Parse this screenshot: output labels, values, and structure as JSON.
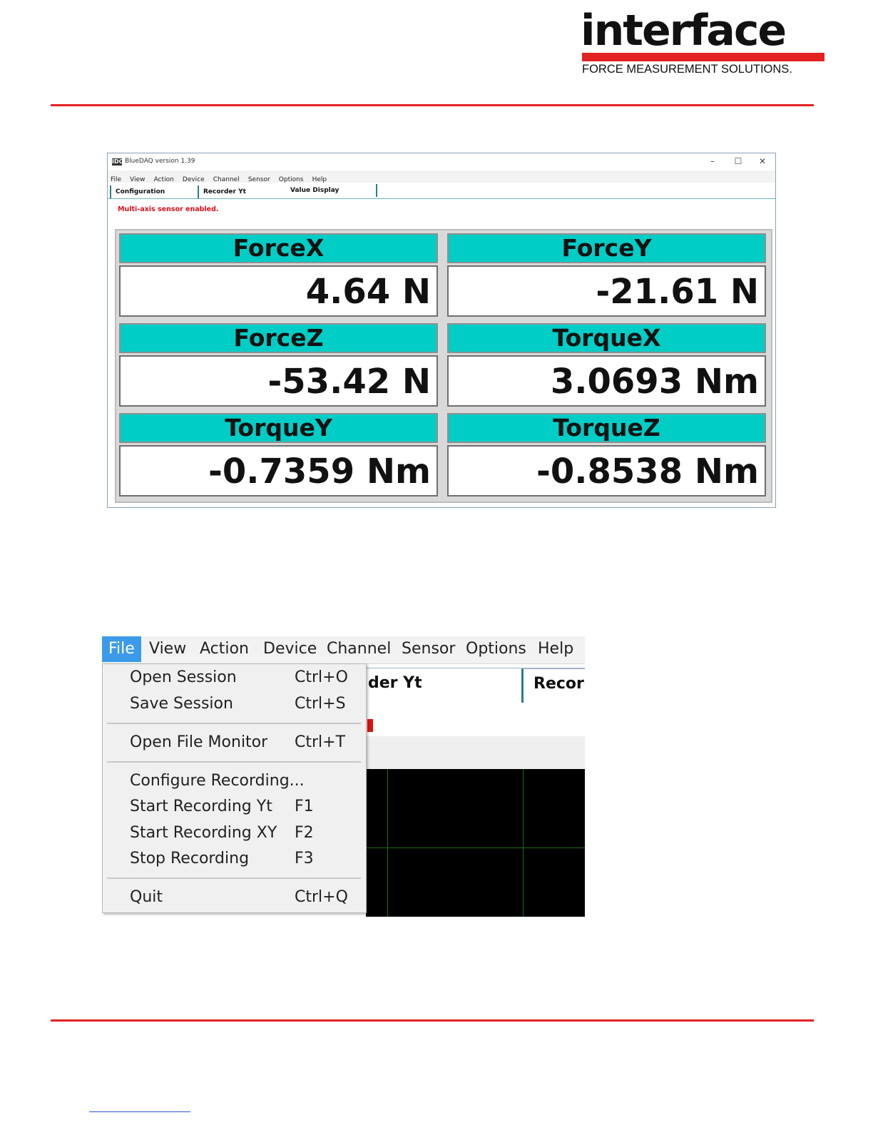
{
  "header": {
    "logo_word": "interface",
    "logo_tagline": "FORCE MEASUREMENT SOLUTIONS."
  },
  "window": {
    "title": "BlueDAQ version 1.39",
    "app_icon_text": "IDC",
    "controls": {
      "minimize": "–",
      "maximize": "☐",
      "close": "✕"
    },
    "menu": [
      "File",
      "View",
      "Action",
      "Device",
      "Channel",
      "Sensor",
      "Options",
      "Help"
    ],
    "tabs": [
      "Configuration",
      "Recorder Yt",
      "Value Display"
    ],
    "status_message": "Multi-axis sensor enabled.",
    "readouts": [
      {
        "label": "ForceX",
        "value": "4.64  N"
      },
      {
        "label": "ForceY",
        "value": "-21.61  N"
      },
      {
        "label": "ForceZ",
        "value": "-53.42  N"
      },
      {
        "label": "TorqueX",
        "value": "3.0693  Nm"
      },
      {
        "label": "TorqueY",
        "value": "-0.7359  Nm"
      },
      {
        "label": "TorqueZ",
        "value": "-0.8538  Nm"
      }
    ],
    "colors": {
      "header_cell": "#00cdc6",
      "status_text": "#e0101a"
    }
  },
  "file_menu_shot": {
    "menu": [
      "File",
      "View",
      "Action",
      "Device",
      "Channel",
      "Sensor",
      "Options",
      "Help"
    ],
    "selected": "File",
    "background_tab_fragment": "der Yt",
    "background_tab_2": "Record",
    "items": [
      {
        "label": "Open Session",
        "shortcut": "Ctrl+O"
      },
      {
        "label": "Save Session",
        "shortcut": "Ctrl+S"
      },
      {
        "label": "Open File Monitor",
        "shortcut": "Ctrl+T"
      },
      {
        "label": "Configure Recording...",
        "shortcut": ""
      },
      {
        "label": "Start Recording Yt",
        "shortcut": "F1"
      },
      {
        "label": "Start Recording XY",
        "shortcut": "F2"
      },
      {
        "label": "Stop Recording",
        "shortcut": "F3"
      },
      {
        "label": "Quit",
        "shortcut": "Ctrl+Q"
      }
    ],
    "colors": {
      "selected_menu": "#3c9be9",
      "plot_background": "#000000",
      "plot_grid": "#1e6b1e"
    }
  },
  "brand_colors": {
    "accent_red": "#e32222"
  }
}
